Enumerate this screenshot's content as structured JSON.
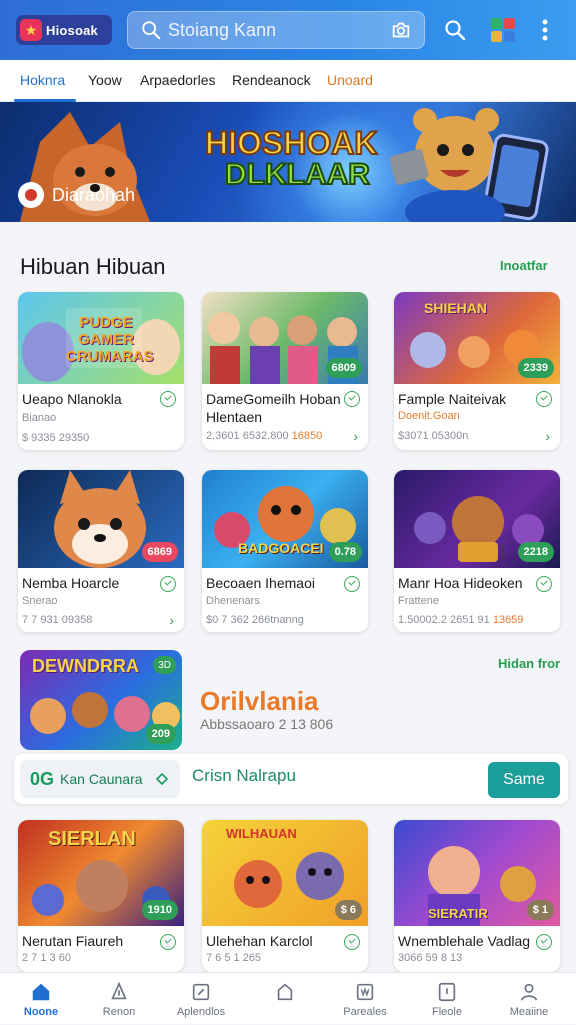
{
  "header": {
    "logo_text": "Hiosoak",
    "search_placeholder": "Stoiang Kann",
    "icons": [
      "search-icon",
      "grid-apps-icon",
      "more-vertical-icon"
    ]
  },
  "tabs": [
    {
      "label": "Hoknra",
      "active": true
    },
    {
      "label": "Yoow"
    },
    {
      "label": "Arpaedorles"
    },
    {
      "label": "Rendeanock"
    },
    {
      "label": "Unoard",
      "highlight": true
    }
  ],
  "banner": {
    "title_line1": "HIOSHOAK",
    "title_line2": "DLKLAAR",
    "badge": "Diaraohah"
  },
  "section1": {
    "title": "Hibuan Hibuan",
    "link": "Inoatfar",
    "cards": [
      {
        "art_text": "PUDGE GAMER CRUMARAS",
        "rate": "",
        "name": "Ueapo Nlanokla",
        "sub": "Bianao",
        "meta": "$ 9335 29350",
        "meta_hl": ""
      },
      {
        "art_text": "",
        "rate": "6809",
        "name": "DameGomeilh Hoban Hlentaen",
        "sub": "",
        "meta": "2,3601 6532.800",
        "meta_hl": "16850"
      },
      {
        "art_text": "SHIEHAN",
        "rate": "2339",
        "name": "Fample Naiteivak",
        "sub": "Doenit.Goan",
        "meta": "$3071 05300n",
        "meta_hl": ""
      },
      {
        "art_text": "",
        "rate": "6869",
        "name": "Nemba Hoarcle",
        "sub": "Snerao",
        "meta": "7 7 931 09358",
        "meta_hl": ""
      },
      {
        "art_text": "BADGOACEI",
        "rate": "0.78",
        "name": "Becoaen Ihemaoi",
        "sub": "Dhenenars",
        "meta": "$0 7 362 266tnanng",
        "meta_hl": ""
      },
      {
        "art_text": "",
        "rate": "2218",
        "name": "Manr Hoa Hideoken",
        "sub": "Frattene",
        "meta": "1.50002.2 2651 91",
        "meta_hl": "13659"
      }
    ]
  },
  "promo": {
    "art_text": "DEWNDRRA",
    "art_badge": "3D",
    "art_rate": "209",
    "title": "Orilvlania",
    "subtitle": "Abbssaoaro 2 13 806",
    "link": "Hidan fror"
  },
  "searchbar": {
    "chip_icon": "0G",
    "chip_label": "Kan Caunara",
    "input": "Crisn Nalrapu",
    "button": "Same"
  },
  "section2": {
    "cards": [
      {
        "art_text": "SIERLAN",
        "rate": "1910",
        "name": "Nerutan Fiaureh",
        "sub": "",
        "meta": "2 7 1 3 60"
      },
      {
        "art_text": "WILHAUAN",
        "rate": "$ 6",
        "name": "Ulehehan Karclol",
        "sub": "",
        "meta": "7 6 5 1 265"
      },
      {
        "art_text": "SIERATIR",
        "rate": "$ 1",
        "name": "Wnemblehale Vadlag",
        "sub": "",
        "meta": "3066 59 8 13"
      }
    ]
  },
  "bottom_nav": [
    {
      "label": "Noone",
      "icon": "home-icon",
      "active": true
    },
    {
      "label": "Renon",
      "icon": "bell-icon"
    },
    {
      "label": "Aplendlos",
      "icon": "compass-icon"
    },
    {
      "label": "",
      "icon": "bag-icon"
    },
    {
      "label": "Pareales",
      "icon": "chart-icon"
    },
    {
      "label": "Fleole",
      "icon": "tablet-icon"
    },
    {
      "label": "Meaiine",
      "icon": "profile-icon"
    }
  ]
}
